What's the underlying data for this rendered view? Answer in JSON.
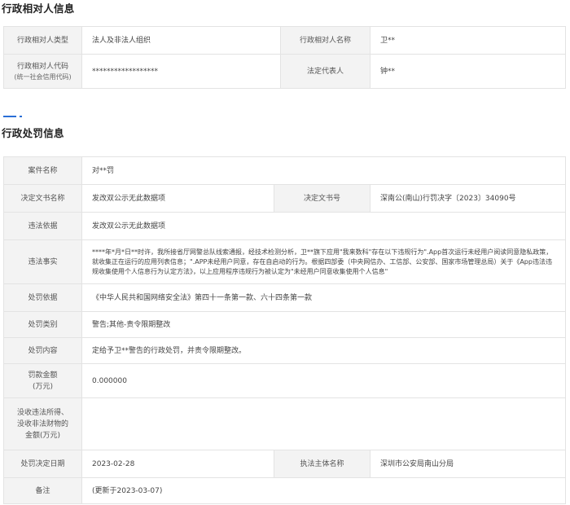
{
  "party_section": {
    "title": "行政相对人信息",
    "type_label": "行政相对人类型",
    "type_value": "法人及非法人组织",
    "name_label": "行政相对人名称",
    "name_value": "卫**",
    "code_label": "行政相对人代码",
    "code_sublabel": "(统一社会信用代码)",
    "code_value": "******************",
    "rep_label": "法定代表人",
    "rep_value": "钟**"
  },
  "penalty_section": {
    "title": "行政处罚信息",
    "rows": {
      "case_name": {
        "label": "案件名称",
        "value": "对**罚"
      },
      "doc_name": {
        "label": "决定文书名称",
        "value": "发改双公示无此数据项"
      },
      "doc_no": {
        "label": "决定文书号",
        "value": "深南公(南山)行罚决字〔2023〕34090号"
      },
      "basis_illegal": {
        "label": "违法依据",
        "value": "发改双公示无此数据项"
      },
      "facts": {
        "label": "违法事实",
        "value": "****年*月*日**时许，我所接省厅网警总队线索通报，经技术检测分析，卫**旗下应用\"我来数科\"存在以下违规行为\".App首次运行未经用户阅读同意隐私政策，就收集正在运行的应用列表信息；\".APP未经用户同意，存在自启动的行为。根据四部委（中央网信办、工信部、公安部、国家市场管理总局）关于《App违法违规收集使用个人信息行为认定方法》，以上应用程序违规行为被认定为\"未经用户同意收集使用个人信息\""
      },
      "basis_penalty": {
        "label": "处罚依据",
        "value": "《中华人民共和国网络安全法》第四十一条第一款、六十四条第一款"
      },
      "category": {
        "label": "处罚类别",
        "value": "警告;其他-责令限期整改"
      },
      "content": {
        "label": "处罚内容",
        "value": "定给予卫**警告的行政处罚，并责令限期整改。"
      },
      "fine": {
        "label_line1": "罚款金额",
        "label_line2": "(万元)",
        "value": "0.000000"
      },
      "confiscated": {
        "label_line1": "没收违法所得、",
        "label_line2": "没收非法财物的",
        "label_line3": "金额(万元)",
        "value": ""
      },
      "decision_date": {
        "label": "处罚决定日期",
        "value": "2023-02-28"
      },
      "authority": {
        "label": "执法主体名称",
        "value": "深圳市公安局南山分局"
      },
      "remark": {
        "label": "备注",
        "value": "(更新于2023-03-07)"
      }
    }
  },
  "colors": {
    "accent": "#2a6fd6",
    "label_bg": "#f3f3f3",
    "border": "#e3e3e3"
  }
}
